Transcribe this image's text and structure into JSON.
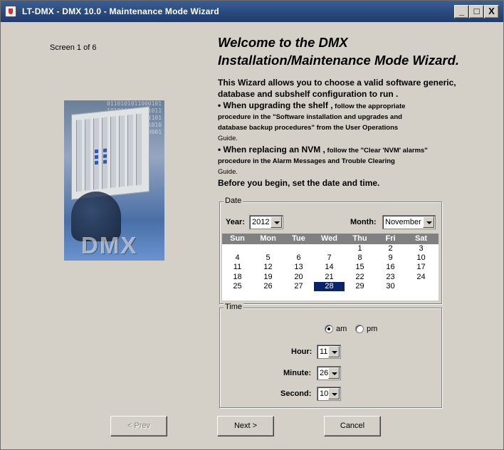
{
  "window": {
    "title": "LT-DMX - DMX 10.0 - Maintenance Mode Wizard",
    "controls": [
      "_",
      "□",
      "X"
    ]
  },
  "screen_label": "Screen 1 of 6",
  "splash_image": {
    "logo_text": "DMX",
    "binary_text": "0110101011000101101000110101101100010110100011010110110001011010001101011011000101101000"
  },
  "heading": {
    "line1": "Welcome to the DMX",
    "line2": "Installation/Maintenance Mode Wizard."
  },
  "description": {
    "intro1": "This Wizard allows you to choose a valid software generic,",
    "intro2": "database and subshelf configuration to run .",
    "shelf_lead": "• When upgrading the shelf ,",
    "shelf_tail1": "follow the appropriate",
    "shelf_tail2": "procedure in the \"Software installation and upgrades and",
    "shelf_tail3": "database backup procedures\" from the User Operations",
    "shelf_tail4": "Guide.",
    "nvm_lead": "• When replacing an NVM ,",
    "nvm_tail1": "follow the \"Clear 'NVM' alarms\"",
    "nvm_tail2": "procedure in the Alarm Messages and Trouble Clearing",
    "nvm_tail3": "Guide.",
    "closing": "Before you begin, set the date and time."
  },
  "date_group": {
    "legend": "Date",
    "year_label": "Year:",
    "year_value": "2012",
    "month_label": "Month:",
    "month_value": "November",
    "weekdays": [
      "Sun",
      "Mon",
      "Tue",
      "Wed",
      "Thu",
      "Fri",
      "Sat"
    ],
    "days": [
      [
        "",
        "",
        "",
        "",
        "1",
        "2",
        "3"
      ],
      [
        "4",
        "5",
        "6",
        "7",
        "8",
        "9",
        "10"
      ],
      [
        "11",
        "12",
        "13",
        "14",
        "15",
        "16",
        "17"
      ],
      [
        "18",
        "19",
        "20",
        "21",
        "22",
        "23",
        "24"
      ],
      [
        "25",
        "26",
        "27",
        "28",
        "29",
        "30",
        ""
      ]
    ],
    "selected_day": "28"
  },
  "time_group": {
    "legend": "Time",
    "am_label": "am",
    "pm_label": "pm",
    "meridiem": "am",
    "hour_label": "Hour:",
    "hour_value": "11",
    "minute_label": "Minute:",
    "minute_value": "26",
    "second_label": "Second:",
    "second_value": "10"
  },
  "buttons": {
    "prev": "< Prev",
    "next": "Next >",
    "cancel": "Cancel"
  }
}
